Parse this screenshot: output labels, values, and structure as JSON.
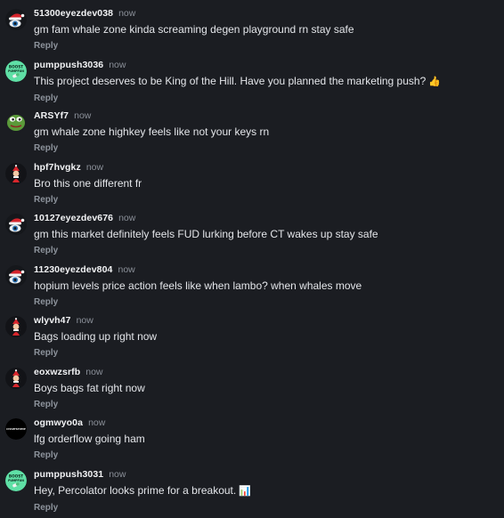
{
  "reply_label": "Reply",
  "colors": {
    "background": "#1b1d22",
    "username": "#f2f3f5",
    "time": "#8b9099",
    "reply": "#8d939c"
  },
  "comments": [
    {
      "username": "51300eyezdev038",
      "time": "now",
      "text": "gm fam whale zone kinda screaming degen playground rn stay safe",
      "avatar": "santa-eye-avatar"
    },
    {
      "username": "pumppush3036",
      "time": "now",
      "text": "This project deserves to be King of the Hill. Have you planned the marketing push?",
      "emoji": "👍",
      "avatar": "boost-pumpfun-avatar",
      "avatar_text": "BOOST PUMPFUN"
    },
    {
      "username": "ARSYf7",
      "time": "now",
      "text": "gm whale zone highkey feels like not your keys rn",
      "avatar": "pepe-avatar"
    },
    {
      "username": "hpf7hvgkz",
      "time": "now",
      "text": "Bro this one different fr",
      "avatar": "red-figure-avatar"
    },
    {
      "username": "10127eyezdev676",
      "time": "now",
      "text": "gm this market definitely feels FUD lurking before CT wakes up stay safe",
      "avatar": "santa-eye-avatar"
    },
    {
      "username": "11230eyezdev804",
      "time": "now",
      "text": "hopium levels price action feels like when lambo? when whales move",
      "avatar": "santa-eye-avatar"
    },
    {
      "username": "wlyvh47",
      "time": "now",
      "text": "Bags loading up right now",
      "avatar": "red-figure-avatar"
    },
    {
      "username": "eoxwzsrfb",
      "time": "now",
      "text": "Boys bags fat right now",
      "avatar": "red-figure-avatar"
    },
    {
      "username": "ogmwyo0a",
      "time": "now",
      "text": "lfg orderflow going ham",
      "avatar": "black-logo-avatar",
      "avatar_text": "CHARTSPUMP"
    },
    {
      "username": "pumppush3031",
      "time": "now",
      "text": "Hey, Percolator looks prime for a breakout.",
      "emoji": "📊",
      "avatar": "boost-pumpfun-avatar",
      "avatar_text": "BOOST PUMPFUN"
    }
  ]
}
